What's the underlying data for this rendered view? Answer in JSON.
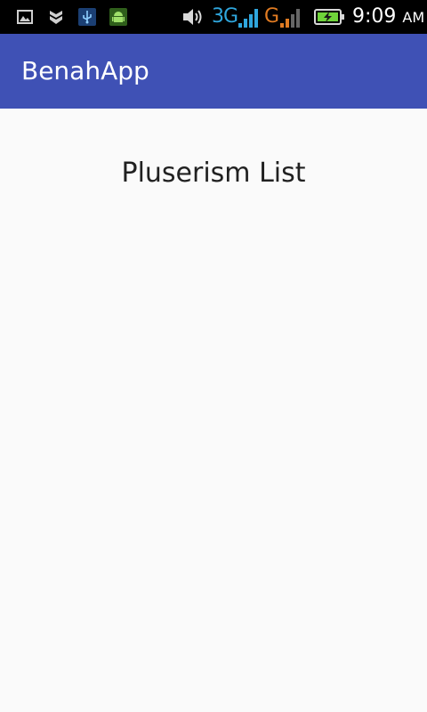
{
  "status_bar": {
    "time": "9:09",
    "ampm": "AM",
    "network_3g": "3G",
    "network_g": "G",
    "colors": {
      "background": "#000000",
      "network_3g": "#2fa6dd",
      "network_g": "#e07b22",
      "battery_fill": "#6fd43a"
    },
    "icons": [
      "gallery-icon",
      "notification-shield-icon",
      "usb-icon",
      "android-debug-icon",
      "volume-icon",
      "signal-3g-icon",
      "signal-g-icon",
      "battery-charging-icon"
    ]
  },
  "app_bar": {
    "title": "BenahApp",
    "color": "#3f51b5"
  },
  "main": {
    "heading": "Pluserism List"
  }
}
